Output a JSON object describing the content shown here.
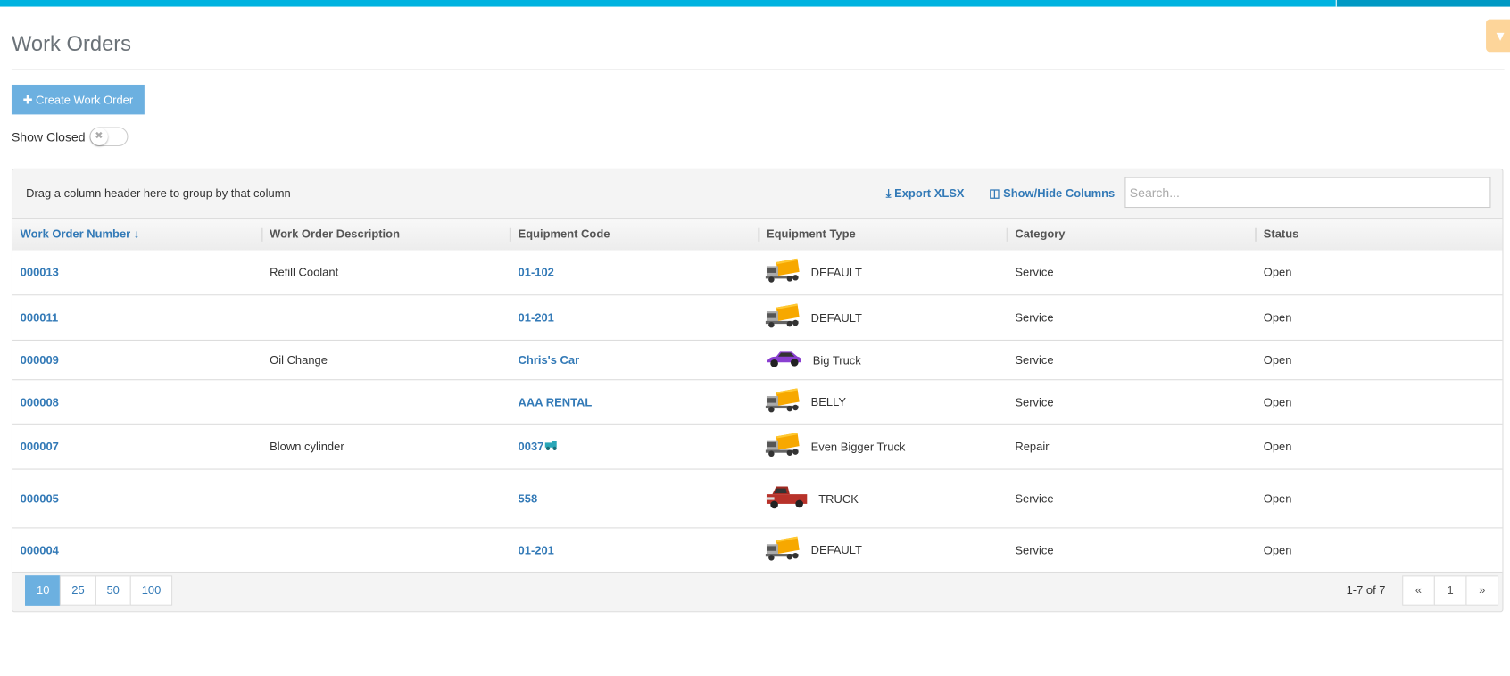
{
  "page": {
    "title": "Work Orders",
    "create_label": "Create Work Order",
    "show_closed_label": "Show Closed",
    "show_closed": false
  },
  "toolbar": {
    "group_hint": "Drag a column header here to group by that column",
    "export_label": "Export XLSX",
    "columns_label": "Show/Hide Columns",
    "search_placeholder": "Search..."
  },
  "columns": [
    "Work Order Number",
    "Work Order Description",
    "Equipment Code",
    "Equipment Type",
    "Category",
    "Status"
  ],
  "rows": [
    {
      "number": "000013",
      "description": "Refill Coolant",
      "code": "01-102",
      "type": "DEFAULT",
      "icon": "box-truck-icon",
      "category": "Service",
      "status": "Open"
    },
    {
      "number": "000011",
      "description": "",
      "code": "01-201",
      "type": "DEFAULT",
      "icon": "box-truck-icon",
      "category": "Service",
      "status": "Open"
    },
    {
      "number": "000009",
      "description": "Oil Change",
      "code": "Chris's Car",
      "type": "Big Truck",
      "icon": "purple-car-icon",
      "category": "Service",
      "status": "Open"
    },
    {
      "number": "000008",
      "description": "",
      "code": "AAA RENTAL",
      "type": "BELLY",
      "icon": "box-truck-icon",
      "category": "Service",
      "status": "Open"
    },
    {
      "number": "000007",
      "description": "Blown cylinder",
      "code": "0037",
      "type": "Even Bigger Truck",
      "icon": "box-truck-icon",
      "category": "Repair",
      "status": "Open"
    },
    {
      "number": "000005",
      "description": "",
      "code": "558",
      "type": "TRUCK",
      "icon": "red-pickup-icon",
      "category": "Service",
      "status": "Open"
    },
    {
      "number": "000004",
      "description": "",
      "code": "01-201",
      "type": "DEFAULT",
      "icon": "box-truck-icon",
      "category": "Service",
      "status": "Open"
    }
  ],
  "pager": {
    "sizes": [
      "10",
      "25",
      "50",
      "100"
    ],
    "active_size": "10",
    "summary": "1-7 of 7",
    "prev": "«",
    "page": "1",
    "next": "»"
  },
  "colors": {
    "accent": "#00b3e0",
    "link": "#337ab7",
    "button": "#6cb0e0"
  }
}
